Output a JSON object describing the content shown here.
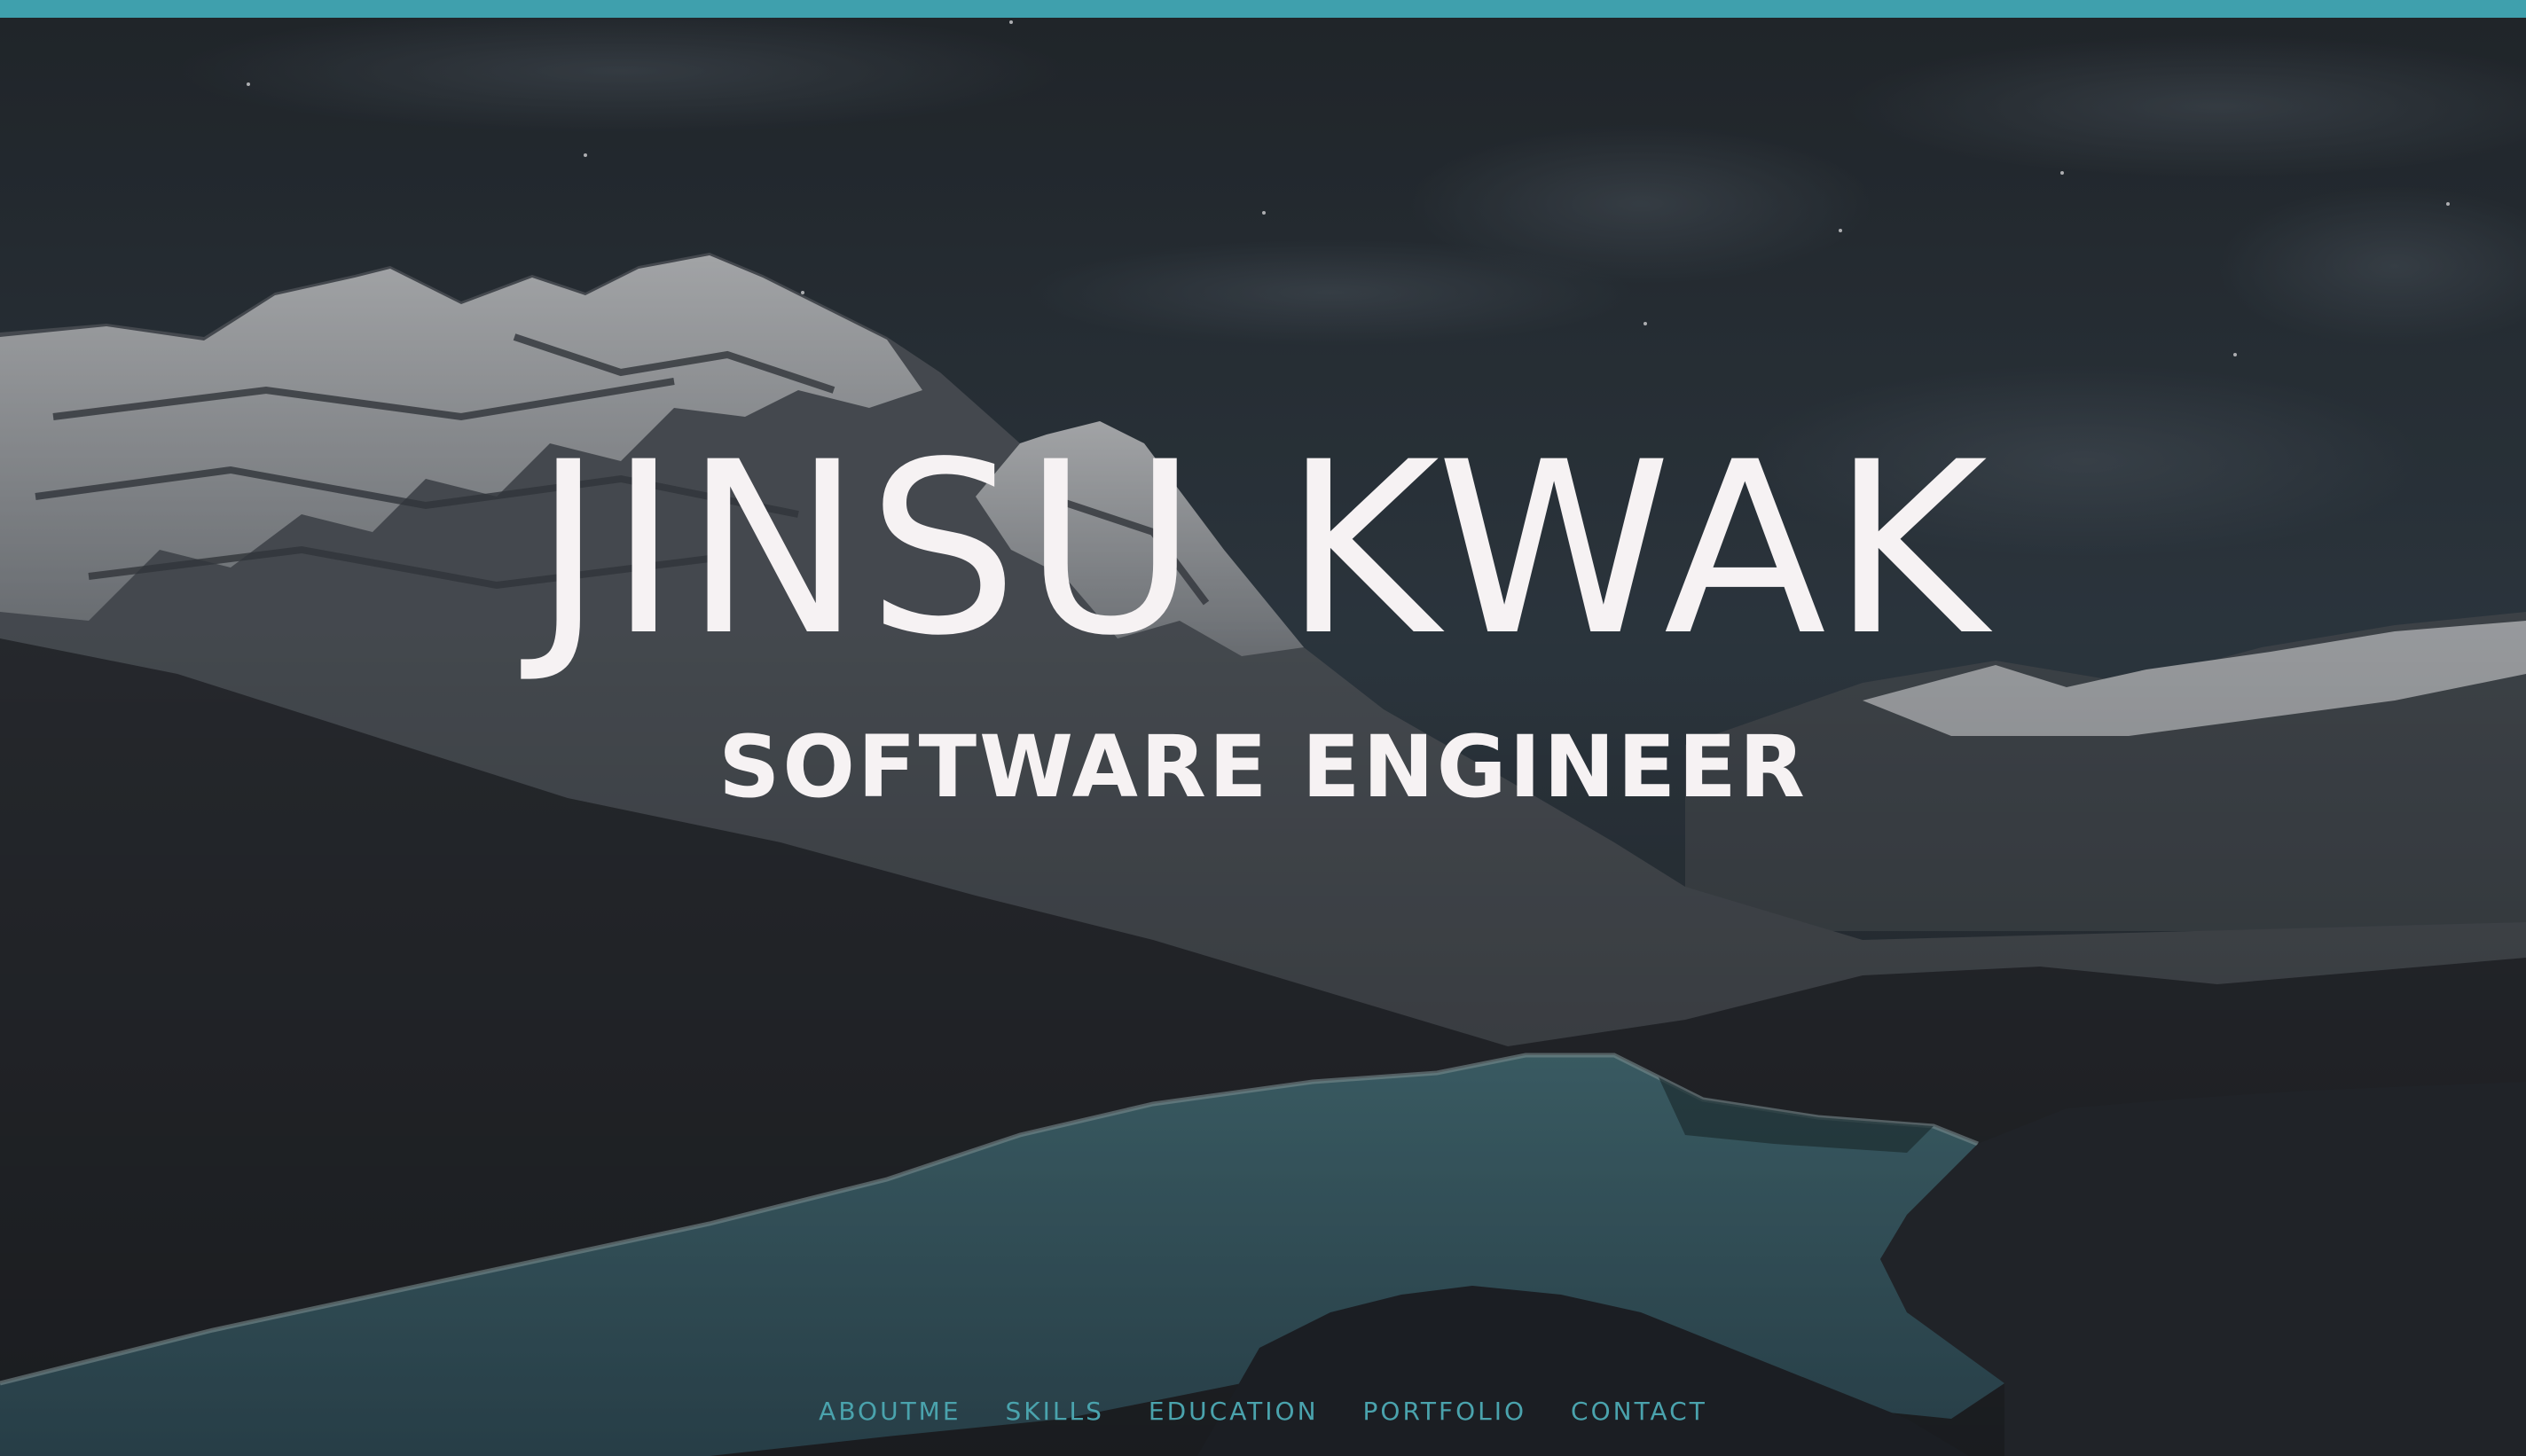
{
  "hero": {
    "name": "JINSU KWAK",
    "role": "SOFTWARE ENGINEER",
    "background": "night-mountain-lake-photo"
  },
  "nav": {
    "items": [
      {
        "label": "ABOUTME"
      },
      {
        "label": "SKILLS"
      },
      {
        "label": "EDUCATION"
      },
      {
        "label": "PORTFOLIO"
      },
      {
        "label": "CONTACT"
      }
    ]
  },
  "colors": {
    "accent": "#3fa0ad",
    "nav_text": "#4aa3ad",
    "hero_text": "#f6f2f3",
    "lake": "#3c6a75"
  }
}
